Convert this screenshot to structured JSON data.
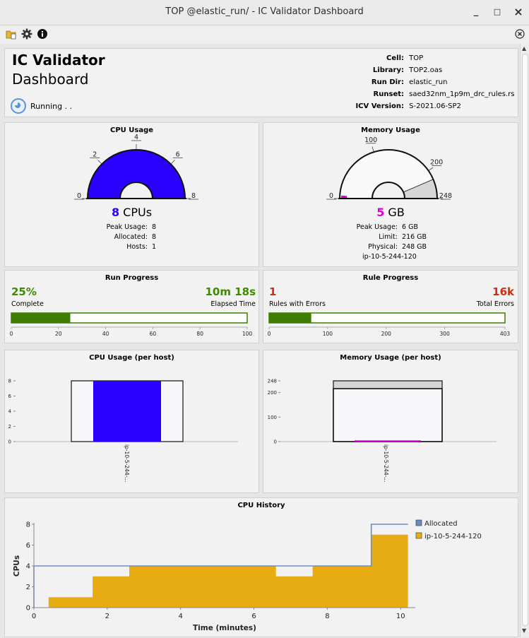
{
  "window": {
    "title": "TOP @elastic_run/ - IC Validator Dashboard",
    "minimize": "_",
    "maximize": "□",
    "close": "×"
  },
  "header": {
    "app_title": "IC Validator",
    "app_subtitle": "Dashboard",
    "status": "Running . .",
    "info": [
      {
        "key": "Cell:",
        "value": "TOP"
      },
      {
        "key": "Library:",
        "value": "TOP2.oas"
      },
      {
        "key": "Run Dir:",
        "value": "elastic_run"
      },
      {
        "key": "Runset:",
        "value": "saed32nm_1p9m_drc_rules.rs"
      },
      {
        "key": "ICV Version:",
        "value": "S-2021.06-SP2"
      }
    ]
  },
  "cpu_usage": {
    "title": "CPU Usage",
    "value": "8",
    "unit": "CPUs",
    "gauge": {
      "min": 0,
      "max": 8,
      "value": 8,
      "ticks": [
        "0",
        "2",
        "4",
        "6",
        "8"
      ],
      "fill_color": "#2a00ff"
    },
    "stats": [
      {
        "key": "Peak Usage:",
        "value": "8"
      },
      {
        "key": "Allocated:",
        "value": "8"
      },
      {
        "key": "Hosts:",
        "value": "1"
      }
    ]
  },
  "memory_usage": {
    "title": "Memory Usage",
    "value": "5",
    "unit": "GB",
    "gauge": {
      "min": 0,
      "max": 248,
      "value": 5,
      "limit": 216,
      "ticks": [
        "0",
        "100",
        "200",
        "248"
      ],
      "fill_color": "#dd00dd"
    },
    "stats": [
      {
        "key": "Peak Usage:",
        "value": "6 GB"
      },
      {
        "key": "Limit:",
        "value": "216 GB"
      },
      {
        "key": "Physical:",
        "value": "248 GB"
      }
    ],
    "host": "ip-10-5-244-120"
  },
  "run_progress": {
    "title": "Run Progress",
    "left_value": "25%",
    "left_label": "Complete",
    "right_value": "10m 18s",
    "right_label": "Elapsed Time",
    "bar": {
      "value": 25,
      "max": 100,
      "ticks": [
        "0",
        "20",
        "40",
        "60",
        "80",
        "100"
      ]
    }
  },
  "rule_progress": {
    "title": "Rule Progress",
    "left_value": "1",
    "left_label": "Rules with Errors",
    "right_value": "16k",
    "right_label": "Total Errors",
    "bar": {
      "value": 72,
      "max": 403,
      "ticks": [
        "0",
        "100",
        "200",
        "300",
        "403"
      ]
    }
  },
  "cpu_per_host": {
    "title": "CPU Usage (per host)",
    "y_ticks": [
      "0",
      "2",
      "4",
      "6",
      "8"
    ],
    "host_label": "ip-10-5-244-...",
    "allocated": 8,
    "used": 8,
    "ymax": 8
  },
  "memory_per_host": {
    "title": "Memory Usage (per host)",
    "y_ticks": [
      "0",
      "100",
      "200",
      "248"
    ],
    "host_label": "ip-10-5-244-...",
    "physical": 248,
    "limit": 216,
    "used": 5,
    "ymax": 248
  },
  "chart_data": {
    "type": "area",
    "title": "CPU History",
    "xlabel": "Time (minutes)",
    "ylabel": "CPUs",
    "xlim": [
      0,
      10.4
    ],
    "ylim": [
      0,
      8
    ],
    "x_ticks": [
      "0",
      "2",
      "4",
      "6",
      "8",
      "10"
    ],
    "y_ticks": [
      "0",
      "2",
      "4",
      "6",
      "8"
    ],
    "legend_position": "top-right",
    "series": [
      {
        "name": "Allocated",
        "kind": "step-line",
        "color": "#6d8cc4",
        "points": [
          [
            0,
            0
          ],
          [
            0,
            4
          ],
          [
            9.2,
            4
          ],
          [
            9.2,
            8
          ],
          [
            10.2,
            8
          ]
        ]
      },
      {
        "name": "ip-10-5-244-120",
        "kind": "step-area",
        "color": "#e6ac12",
        "points": [
          [
            0.4,
            1
          ],
          [
            1.6,
            3
          ],
          [
            2.6,
            4
          ],
          [
            6.6,
            3
          ],
          [
            7.6,
            4
          ],
          [
            9.2,
            7
          ],
          [
            10.2,
            8
          ]
        ]
      }
    ]
  }
}
